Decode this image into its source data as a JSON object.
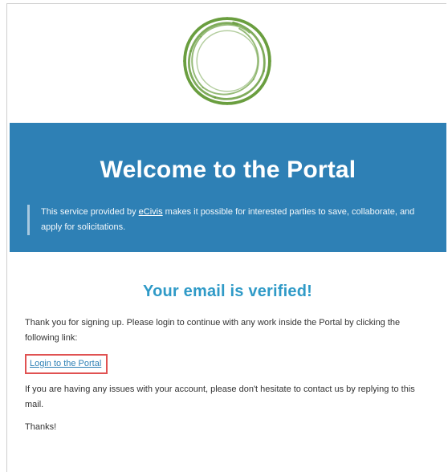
{
  "logo": {
    "icon": "circular-swirl-logo-icon",
    "color": "#6a9e3f"
  },
  "banner": {
    "title": "Welcome to the Portal",
    "text_before_link": "This service provided by ",
    "link_text": "eCivis",
    "text_after_link": " makes it possible for interested parties to save, collaborate, and apply for solicitations.",
    "background_color": "#2e80b5"
  },
  "content": {
    "verified_title": "Your email is verified!",
    "intro": "Thank you for signing up. Please login to continue with any work inside the Portal by clicking the following link:",
    "login_link": "Login to the Portal",
    "issues": "If you are having any issues with your account, please don't hesitate to contact us by replying to this mail.",
    "thanks": "Thanks!"
  },
  "colors": {
    "accent": "#2f9ac7",
    "highlight_border": "#e05252"
  }
}
